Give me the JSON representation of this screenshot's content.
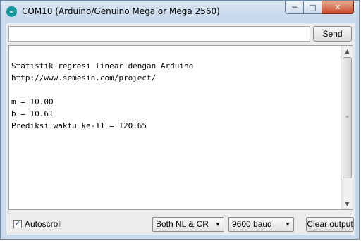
{
  "window": {
    "title": "COM10 (Arduino/Genuino Mega or Mega 2560)",
    "app_icon_glyph": "∞",
    "controls": {
      "minimize": "─",
      "maximize": "□",
      "close": "✕"
    }
  },
  "send_bar": {
    "input_value": "",
    "send_label": "Send"
  },
  "output": {
    "lines": [
      "Statistik regresi linear dengan Arduino",
      "http://www.semesin.com/project/",
      "",
      "m = 10.00",
      "b = 10.61",
      "Prediksi waktu ke-11 = 120.65"
    ]
  },
  "scrollbar": {
    "up_glyph": "▲",
    "down_glyph": "▼",
    "grip_glyph": "≡"
  },
  "bottom_bar": {
    "autoscroll_label": "Autoscroll",
    "autoscroll_checked": true,
    "autoscroll_mark": "✓",
    "line_ending": "Both NL & CR",
    "baud_rate": "9600 baud",
    "dropdown_glyph": "▼",
    "clear_label": "Clear output"
  }
}
